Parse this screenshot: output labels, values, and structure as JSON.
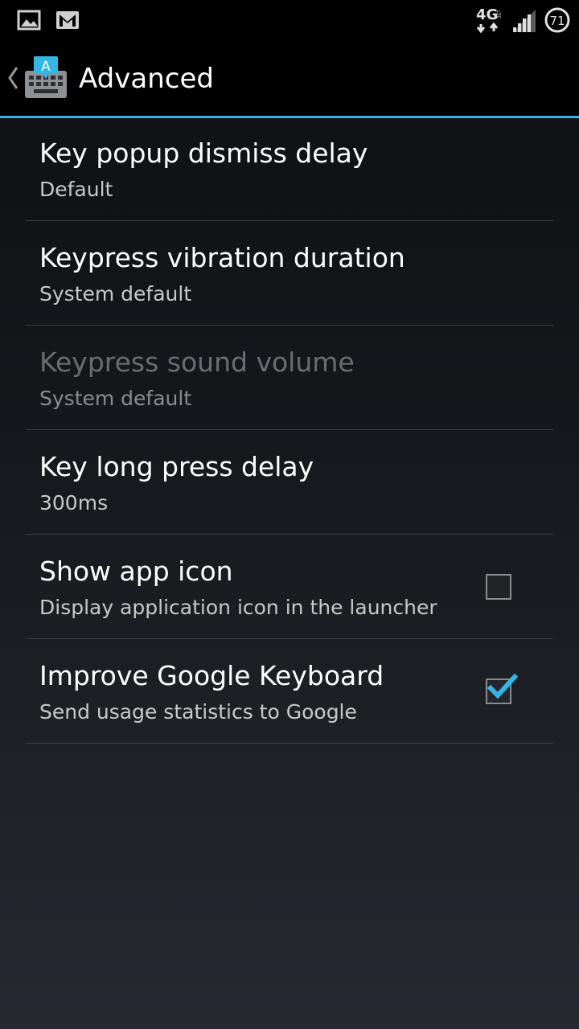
{
  "status_bar": {
    "left_icons": [
      "image-icon",
      "gmail-icon"
    ],
    "network": "4G LTE",
    "battery_level": "71"
  },
  "action_bar": {
    "title": "Advanced",
    "app_icon_letter": "A"
  },
  "colors": {
    "accent": "#33b5e5",
    "background_top": "#0d0f12",
    "background_bottom": "#262a30",
    "divider": "#3a3d42"
  },
  "preferences": [
    {
      "title": "Key popup dismiss delay",
      "summary": "Default",
      "enabled": true
    },
    {
      "title": "Keypress vibration duration",
      "summary": "System default",
      "enabled": true
    },
    {
      "title": "Keypress sound volume",
      "summary": "System default",
      "enabled": false
    },
    {
      "title": "Key long press delay",
      "summary": "300ms",
      "enabled": true
    },
    {
      "title": "Show app icon",
      "summary": "Display application icon in the launcher",
      "enabled": true,
      "checkbox": true,
      "checked": false
    },
    {
      "title": "Improve Google Keyboard",
      "summary": "Send usage statistics to Google",
      "enabled": true,
      "checkbox": true,
      "checked": true
    }
  ]
}
